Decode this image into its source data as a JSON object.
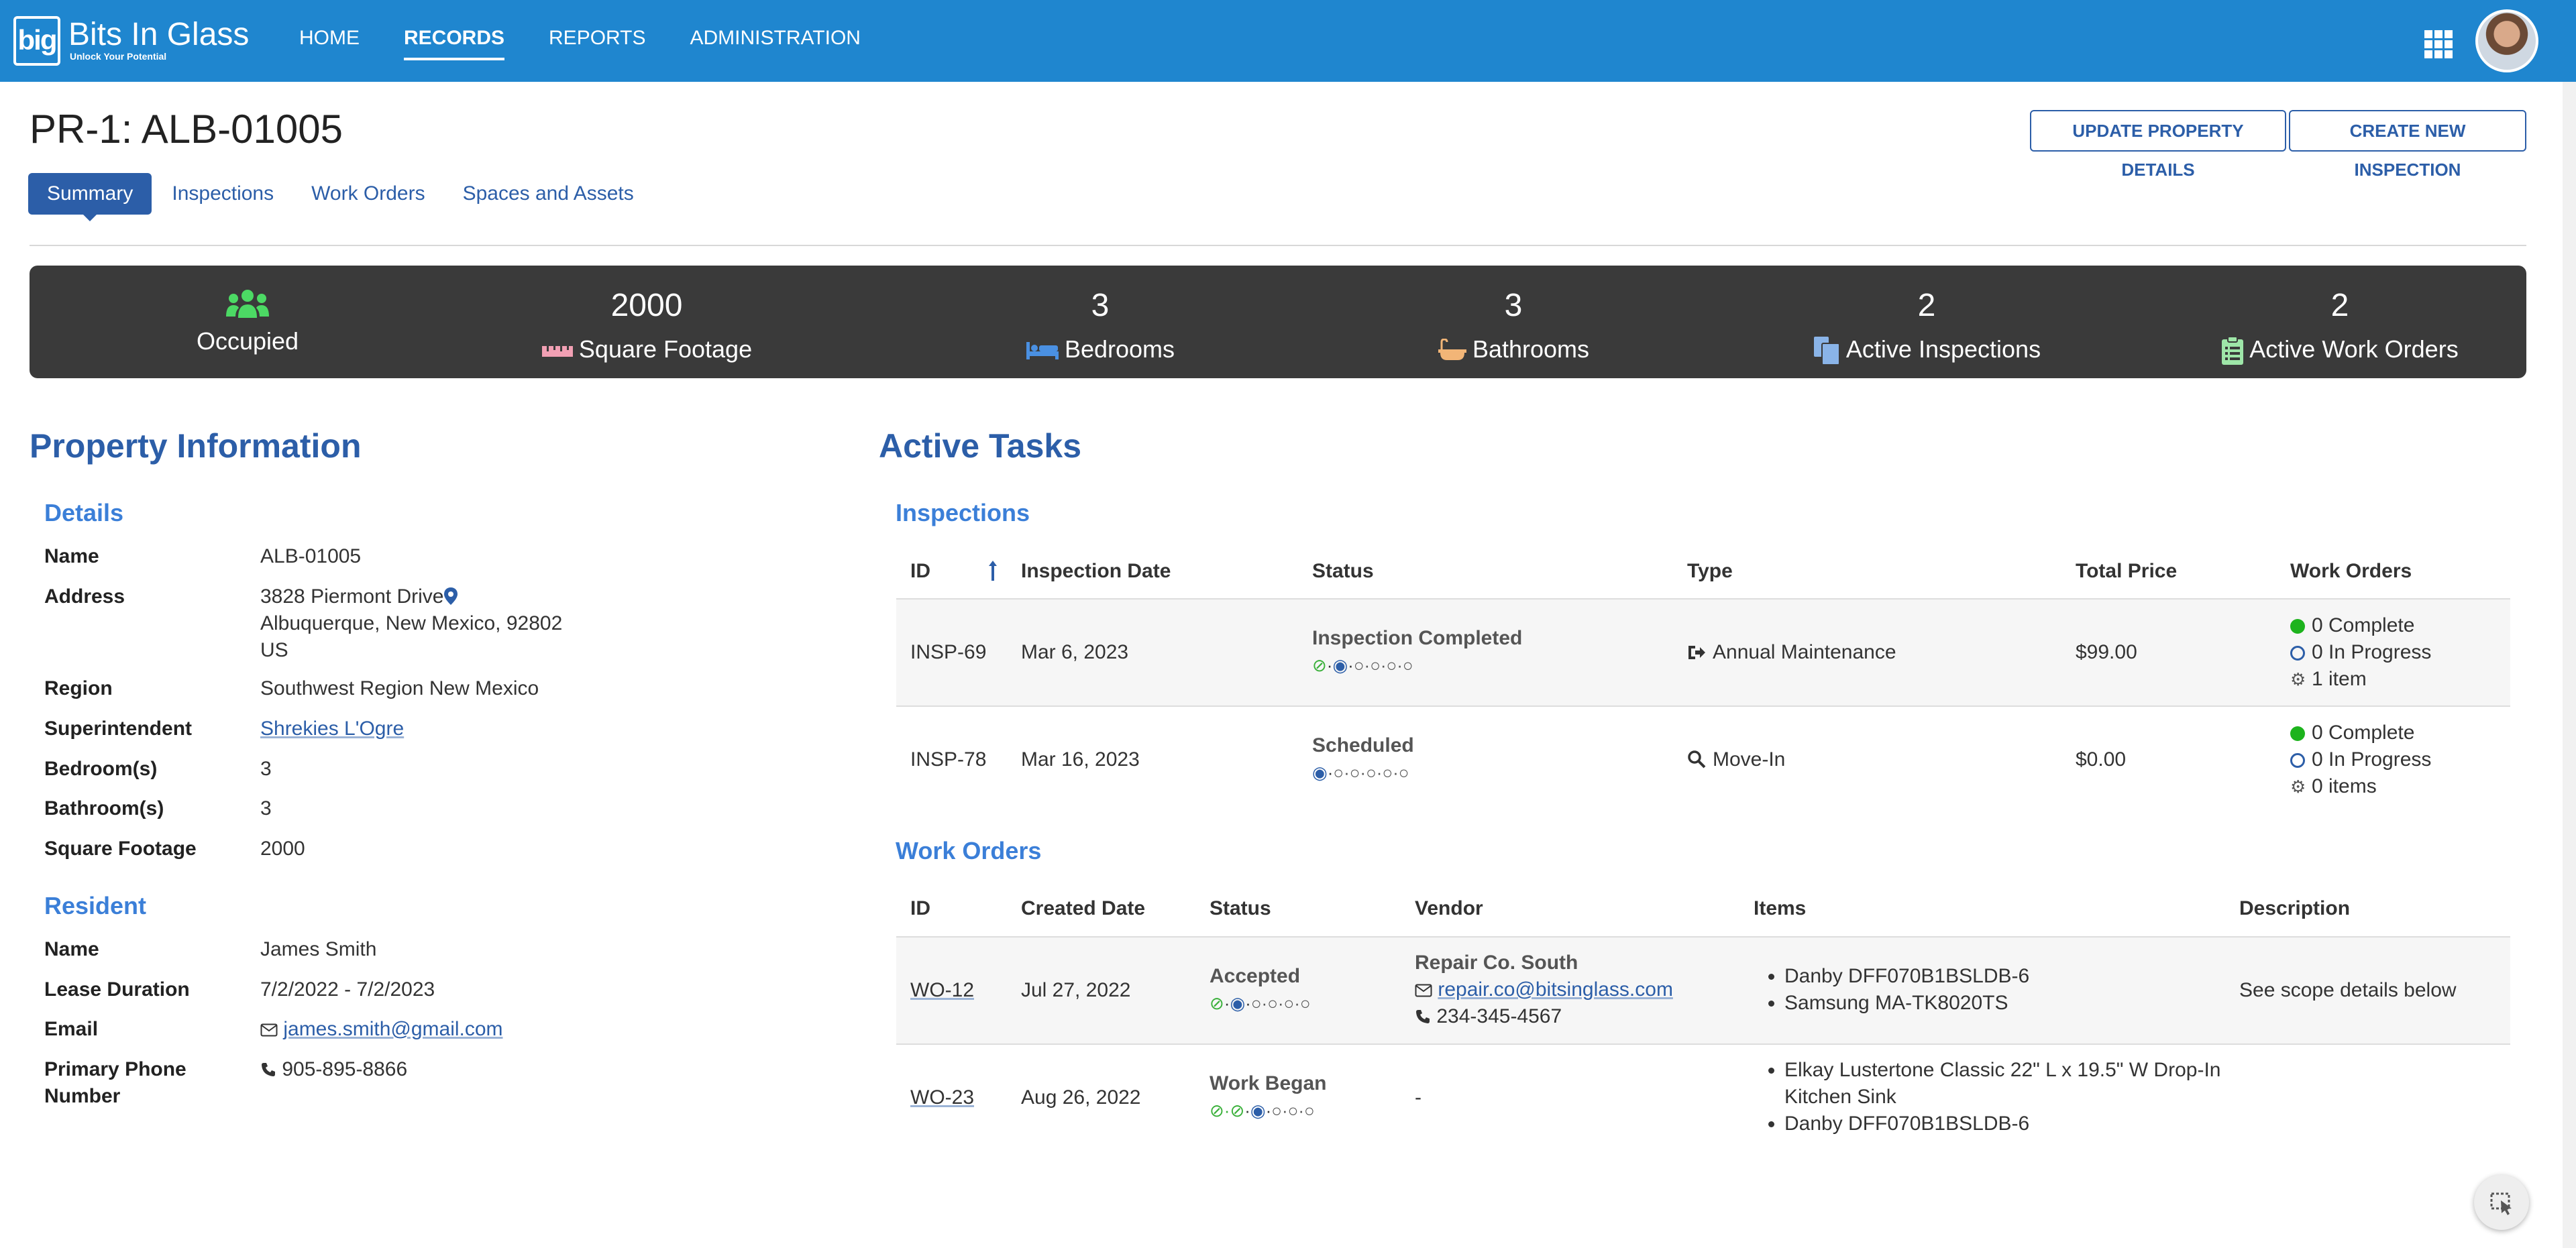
{
  "app": {
    "logo_mark": "big",
    "name": "Bits In Glass",
    "tagline": "Unlock Your Potential",
    "nav": [
      "HOME",
      "RECORDS",
      "REPORTS",
      "ADMINISTRATION"
    ],
    "active_nav": "RECORDS",
    "icons": [
      "apps-grid-icon",
      "avatar"
    ]
  },
  "header": {
    "title": "PR-1: ALB-01005",
    "update_button": "UPDATE PROPERTY DETAILS",
    "create_button": "CREATE NEW INSPECTION"
  },
  "tabs": [
    "Summary",
    "Inspections",
    "Work Orders",
    "Spaces and Assets"
  ],
  "active_tab": "Summary",
  "stats": {
    "occupancy": "Occupied",
    "square_footage": {
      "value": "2000",
      "label": "Square Footage"
    },
    "bedrooms": {
      "value": "3",
      "label": "Bedrooms"
    },
    "bathrooms": {
      "value": "3",
      "label": "Bathrooms"
    },
    "active_inspections": {
      "value": "2",
      "label": "Active Inspections"
    },
    "active_work_orders": {
      "value": "2",
      "label": "Active Work Orders"
    }
  },
  "property": {
    "heading": "Property Information",
    "details_heading": "Details",
    "details": {
      "name_label": "Name",
      "name": "ALB-01005",
      "address_label": "Address",
      "address_line1": "3828 Piermont Drive",
      "address_line2": "Albuquerque, New Mexico, 92802",
      "address_line3": "US",
      "region_label": "Region",
      "region": "Southwest Region New Mexico",
      "super_label": "Superintendent",
      "superintendent": "Shrekies L'Ogre",
      "bed_label": "Bedroom(s)",
      "bedrooms": "3",
      "bath_label": "Bathroom(s)",
      "bathrooms": "3",
      "sqft_label": "Square Footage",
      "square_footage": "2000"
    },
    "resident_heading": "Resident",
    "resident": {
      "name_label": "Name",
      "name": "James Smith",
      "lease_label": "Lease Duration",
      "lease": "7/2/2022 - 7/2/2023",
      "email_label": "Email",
      "email": "james.smith@gmail.com",
      "phone_label_1": "Primary Phone",
      "phone_label_2": "Number",
      "phone": "905-895-8866"
    }
  },
  "tasks": {
    "heading": "Active Tasks",
    "inspections_heading": "Inspections",
    "inspection_columns": [
      "ID",
      "Inspection Date",
      "Status",
      "Type",
      "Total Price",
      "Work Orders"
    ],
    "inspections": [
      {
        "id": "INSP-69",
        "date": "Mar 6, 2023",
        "status": "Inspection Completed",
        "type": "Annual Maintenance",
        "type_icon": "sign-out-icon",
        "price": "$99.00",
        "complete": "0 Complete",
        "in_progress": "0 In Progress",
        "items": "1 item",
        "progress": {
          "done": 1,
          "current": 1,
          "steps": 6
        }
      },
      {
        "id": "INSP-78",
        "date": "Mar 16, 2023",
        "status": "Scheduled",
        "type": "Move-In",
        "type_icon": "search-icon",
        "price": "$0.00",
        "complete": "0 Complete",
        "in_progress": "0 In Progress",
        "items": "0 items",
        "progress": {
          "done": 0,
          "current": 1,
          "steps": 6
        }
      }
    ],
    "work_orders_heading": "Work Orders",
    "work_order_columns": [
      "ID",
      "Created Date",
      "Status",
      "Vendor",
      "Items",
      "Description"
    ],
    "work_orders": [
      {
        "id": "WO-12",
        "date": "Jul 27, 2022",
        "status": "Accepted",
        "vendor_name": "Repair Co. South",
        "vendor_email": "repair.co@bitsinglass.com",
        "vendor_phone": "234-345-4567",
        "items": [
          "Danby DFF070B1BSLDB-6",
          "Samsung MA-TK8020TS"
        ],
        "description": "See scope details below",
        "progress": {
          "done": 1,
          "current": 1,
          "steps": 6
        }
      },
      {
        "id": "WO-23",
        "date": "Aug 26, 2022",
        "status": "Work Began",
        "vendor": "-",
        "items": [
          "Elkay Lustertone Classic 22\" L x 19.5\" W Drop-In",
          "Kitchen Sink",
          "Danby DFF070B1BSLDB-6"
        ],
        "description": "",
        "progress": {
          "done": 2,
          "current": 1,
          "steps": 6
        }
      }
    ]
  },
  "colors": {
    "topbar": "#1f86cf",
    "accent": "#2c5ea8",
    "section_head": "#3b7fd8",
    "stats_band": "#3a3a3a",
    "occupied_green": "#4cd964",
    "complete_green": "#1db31d"
  }
}
